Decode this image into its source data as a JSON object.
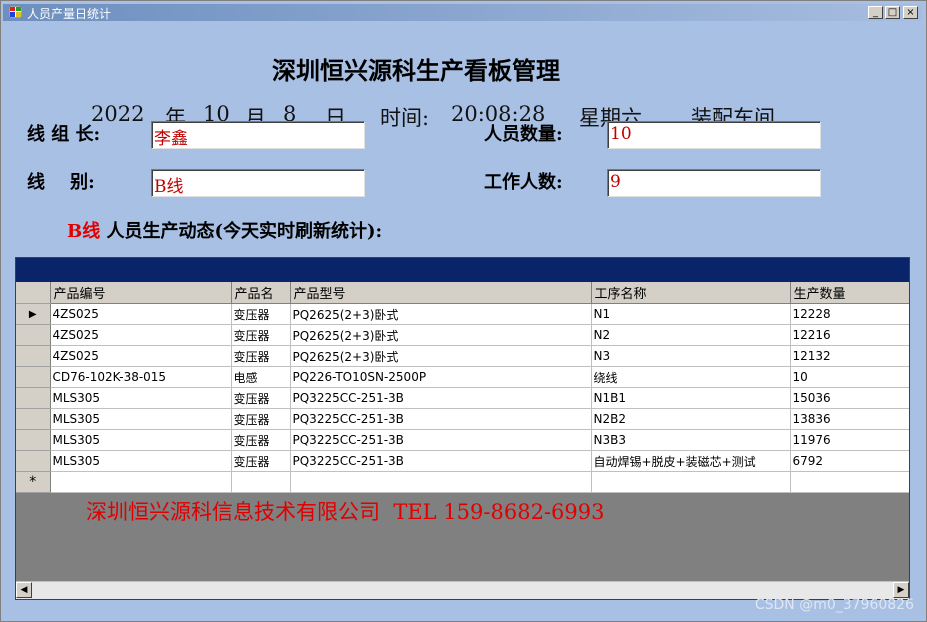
{
  "window": {
    "title": "人员产量日统计"
  },
  "header": {
    "title": "深圳恒兴源科生产看板管理",
    "year": "2022",
    "year_unit": "年",
    "month": "10",
    "month_unit": "月",
    "day": "8",
    "day_unit": "日",
    "time_label": "时间:",
    "time": "20:08:28",
    "weekday": "星期六",
    "workshop": "装配车间"
  },
  "form": {
    "leader_label": "线 组 长:",
    "leader_value": "李鑫",
    "headcount_label": "人员数量:",
    "headcount_value": "10",
    "line_label": "线    别:",
    "line_value": "B线",
    "workers_label": "工作人数:",
    "workers_value": "9"
  },
  "dynamic": {
    "line": "B线",
    "text": " 人员生产动态(今天实时刷新统计):"
  },
  "grid": {
    "columns": [
      "产品编号",
      "产品名",
      "产品型号",
      "工序名称",
      "生产数量"
    ],
    "current_row_marker": "▶",
    "new_row_marker": "*",
    "rows": [
      [
        "4ZS025",
        "变压器",
        "PQ2625(2+3)卧式",
        "N1",
        "12228"
      ],
      [
        "4ZS025",
        "变压器",
        "PQ2625(2+3)卧式",
        "N2",
        "12216"
      ],
      [
        "4ZS025",
        "变压器",
        "PQ2625(2+3)卧式",
        "N3",
        "12132"
      ],
      [
        "CD76-102K-38-015",
        "电感",
        "PQ226-TO10SN-2500P",
        "绕线",
        "10"
      ],
      [
        "MLS305",
        "变压器",
        "PQ3225CC-251-3B",
        "N1B1",
        "15036"
      ],
      [
        "MLS305",
        "变压器",
        "PQ3225CC-251-3B",
        "N2B2",
        "13836"
      ],
      [
        "MLS305",
        "变压器",
        "PQ3225CC-251-3B",
        "N3B3",
        "11976"
      ],
      [
        "MLS305",
        "变压器",
        "PQ3225CC-251-3B",
        "自动焊锡+脱皮+装磁芯+测试",
        "6792"
      ]
    ]
  },
  "footer": {
    "company": "深圳恒兴源科信息技术有限公司  TEL 159-8682-6993"
  },
  "watermark": "CSDN @m0_37960826",
  "colors": {
    "background": "#a8c0e4",
    "accent_red": "#e00000",
    "caption_navy": "#0a246a"
  }
}
